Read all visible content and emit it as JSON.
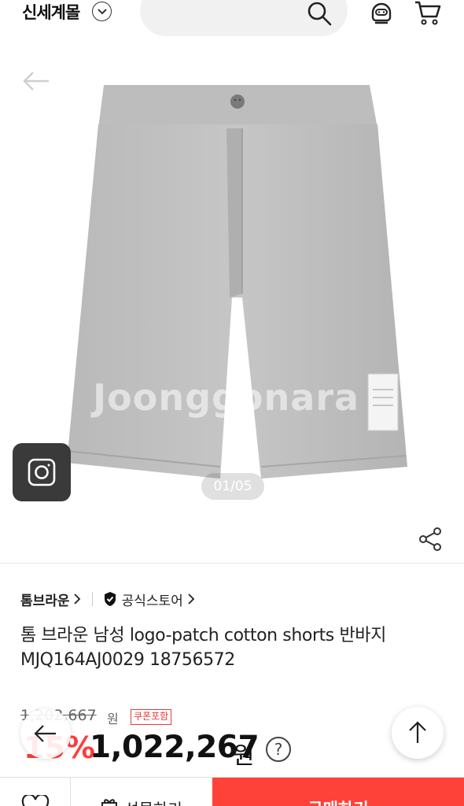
{
  "header": {
    "brand": "신세계몰",
    "icons": [
      "chevron-down-icon",
      "search-icon",
      "chatbot-icon",
      "cart-icon"
    ]
  },
  "gallery": {
    "watermark": "Joonggonara",
    "counter": "01/05"
  },
  "product": {
    "brand_name": "톰브라운",
    "official_store": "공식스토어",
    "title": "톰 브라운 남성 logo-patch cotton shorts 반바지 MJQ164AJ0029 18756572"
  },
  "price": {
    "original": "1,202,667",
    "original_unit": "원",
    "coupon_badge": "쿠폰포함",
    "discount": "15%",
    "sale": "1,022,267",
    "sale_unit": "원",
    "help": "?"
  },
  "bottom_bar": {
    "gift_label": "선물하기",
    "buy_label": "구매하기"
  },
  "colors": {
    "accent": "#ff4239",
    "discount": "#ff3b3b"
  }
}
